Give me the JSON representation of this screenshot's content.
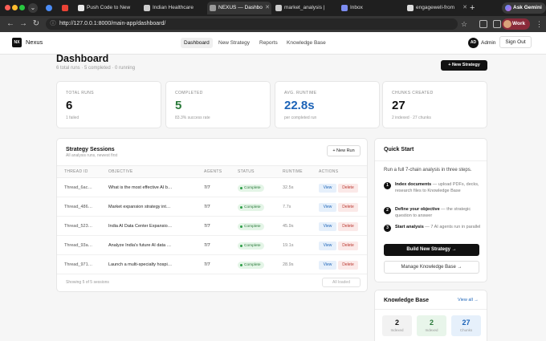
{
  "browser": {
    "tabs": [
      {
        "label": "",
        "pinned": true,
        "favicon_color": "#4b8cf5"
      },
      {
        "label": "",
        "pinned": true,
        "favicon_color": "#ea4335"
      },
      {
        "label": "Push Code to New",
        "favicon_color": "#e8e8e8"
      },
      {
        "label": "Indian Healthcare",
        "favicon_color": "#cccccc"
      },
      {
        "label": "NEXUS — Dashbo",
        "active": true,
        "favicon_color": "#999999"
      },
      {
        "label": "market_analysis |",
        "favicon_color": "#cccccc"
      },
      {
        "label": "Inbox",
        "favicon_color": "#7c8cf0"
      },
      {
        "label": "engagewell-from",
        "favicon_color": "#dddddd"
      }
    ],
    "ask_gemini_label": "Ask Gemini",
    "url": "http://127.0.0.1:8000/main-app/dashboard/",
    "profile_label": "Work"
  },
  "app": {
    "logo_text": "NX",
    "brand": "Nexus",
    "nav": [
      {
        "label": "Dashboard",
        "active": true
      },
      {
        "label": "New Strategy"
      },
      {
        "label": "Reports"
      },
      {
        "label": "Knowledge Base"
      }
    ],
    "user_initials": "AD",
    "user_name": "Admin",
    "sign_out_label": "Sign Out"
  },
  "page": {
    "title": "Dashboard",
    "subtitle": "6 total runs · 5 completed · 0 running",
    "new_strategy_label": "+ New Strategy"
  },
  "stats": [
    {
      "label": "TOTAL RUNS",
      "value": "6",
      "note": "1 failed",
      "color": "#111111"
    },
    {
      "label": "COMPLETED",
      "value": "5",
      "note": "83.3% success rate",
      "color": "#2a7a3a"
    },
    {
      "label": "AVG. RUNTIME",
      "value": "22.8s",
      "note": "per completed run",
      "color": "#1c63b7"
    },
    {
      "label": "CHUNKS CREATED",
      "value": "27",
      "note": "2 indexed · 27 chunks",
      "color": "#111111"
    }
  ],
  "sessions": {
    "title": "Strategy Sessions",
    "subtitle": "All analysis runs, newest first",
    "new_run_label": "+ New Run",
    "columns": [
      "THREAD ID",
      "OBJECTIVE",
      "AGENTS",
      "STATUS",
      "RUNTIME",
      "ACTIONS"
    ],
    "rows": [
      {
        "id": "Thread_6ac…",
        "objective": "What is the most effective AI b…",
        "agents": "7/7",
        "status": "Complete",
        "runtime": "32.5s"
      },
      {
        "id": "Thread_486…",
        "objective": "Market expansion strategy int…",
        "agents": "7/7",
        "status": "Complete",
        "runtime": "7.7s"
      },
      {
        "id": "Thread_523…",
        "objective": "India AI Data Center Expansio…",
        "agents": "7/7",
        "status": "Complete",
        "runtime": "45.9s"
      },
      {
        "id": "Thread_93a…",
        "objective": "Analyze India's future AI data …",
        "agents": "7/7",
        "status": "Complete",
        "runtime": "19.1s"
      },
      {
        "id": "Thread_971…",
        "objective": "Launch a multi-specialty hospi…",
        "agents": "7/7",
        "status": "Complete",
        "runtime": "28.9s"
      }
    ],
    "view_label": "View",
    "delete_label": "Delete",
    "footer": "Showing 5 of 5 sessions",
    "all_loaded_label": "All loaded"
  },
  "quick_start": {
    "title": "Quick Start",
    "intro": "Run a full 7-chain analysis in three steps.",
    "steps": [
      {
        "num": "1",
        "title": "Index documents",
        "text": " — upload PDFs, decks, research files to Knowledge Base"
      },
      {
        "num": "2",
        "title": "Define your objective",
        "text": " — the strategic question to answer"
      },
      {
        "num": "3",
        "title": "Start analysis",
        "text": " — 7 AI agents run in parallel"
      }
    ],
    "build_label": "Build New Strategy →",
    "manage_label": "Manage Knowledge Base →"
  },
  "knowledge_base": {
    "title": "Knowledge Base",
    "view_all_label": "View all →",
    "boxes": [
      {
        "value": "2",
        "label": "Indexed",
        "bg": "#f2f2f2",
        "color": "#111111"
      },
      {
        "value": "2",
        "label": "Indexed",
        "bg": "#e8f5ea",
        "color": "#2a7a3a"
      },
      {
        "value": "27",
        "label": "Chunks",
        "bg": "#e6f0fb",
        "color": "#1c63b7"
      }
    ]
  }
}
